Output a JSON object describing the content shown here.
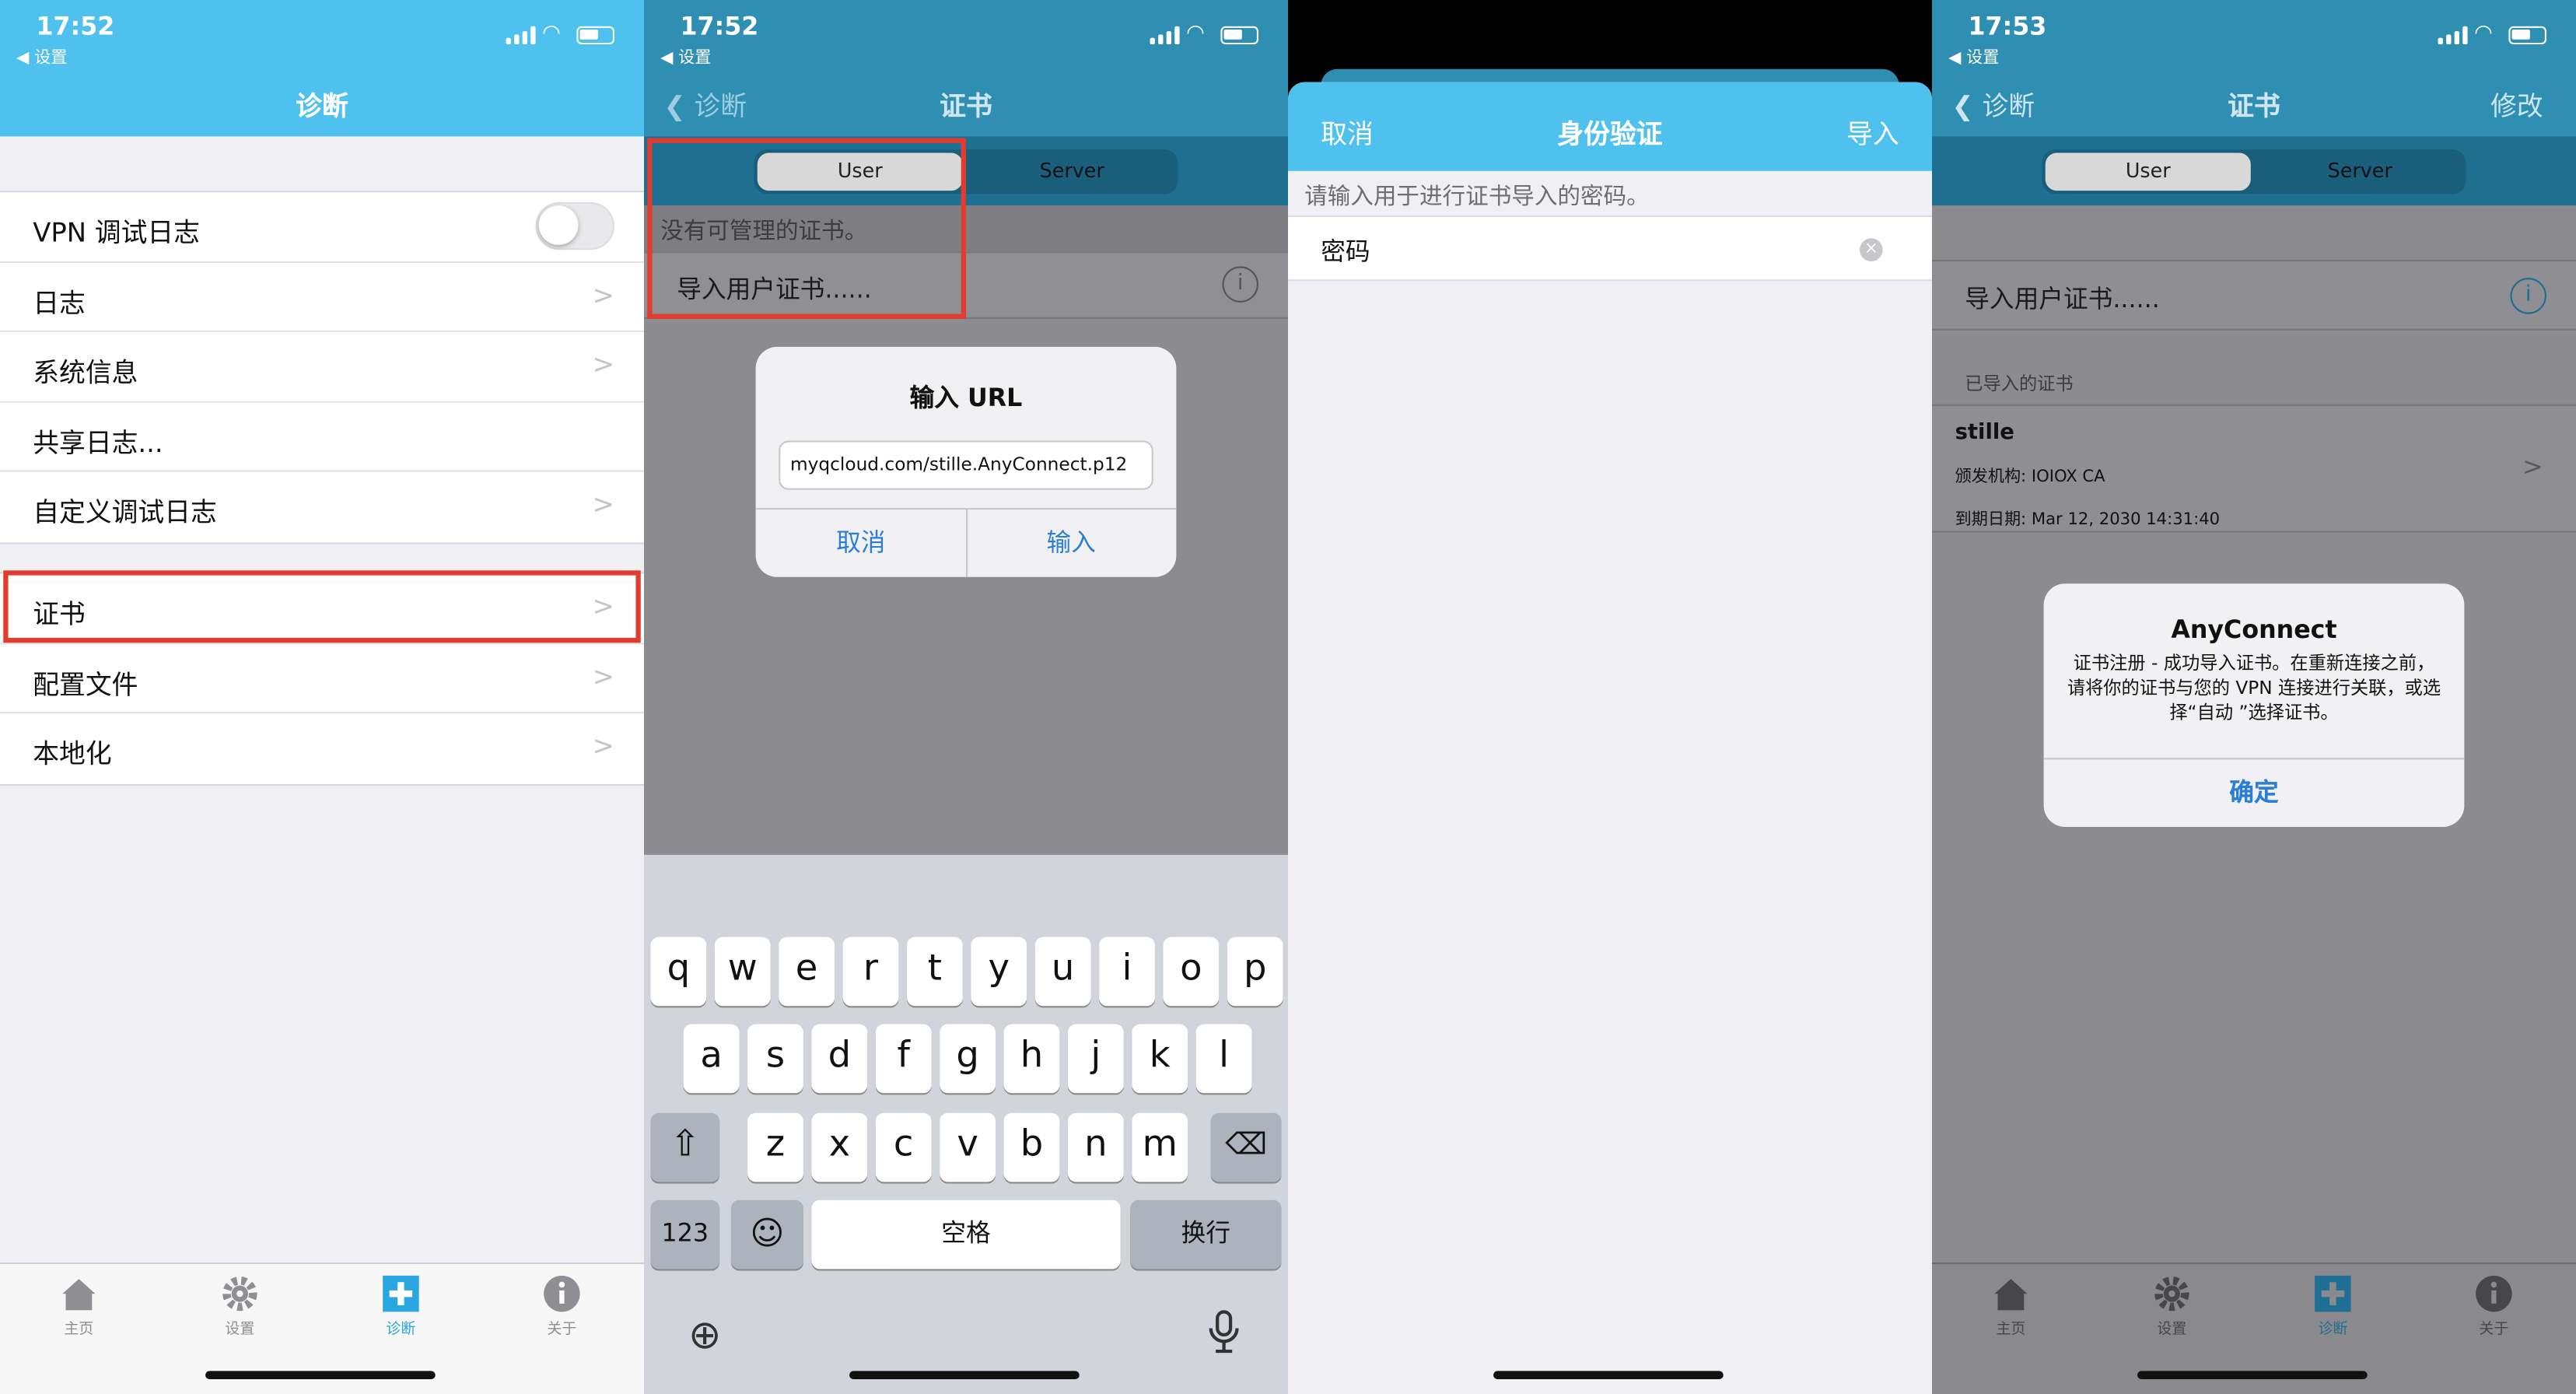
{
  "status": {
    "time_1": "17:52",
    "time_2": "17:52",
    "time_4": "17:53",
    "back_app": "◀ 设置"
  },
  "p1": {
    "title": "诊断",
    "items": [
      {
        "label": "VPN 调试日志"
      },
      {
        "label": "日志"
      },
      {
        "label": "系统信息"
      },
      {
        "label": "共享日志..."
      },
      {
        "label": "自定义调试日志"
      }
    ],
    "items2": [
      {
        "label": "证书"
      },
      {
        "label": "配置文件"
      },
      {
        "label": "本地化"
      }
    ]
  },
  "tabs": {
    "home": "主页",
    "settings": "设置",
    "diag": "诊断",
    "about": "关于"
  },
  "p2": {
    "back": "诊断",
    "title": "证书",
    "seg_user": "User",
    "seg_server": "Server",
    "empty": "没有可管理的证书。",
    "import": "导入用户证书......",
    "alert": {
      "title": "输入 URL",
      "url": "myqcloud.com/stille.AnyConnect.p12",
      "cancel": "取消",
      "ok": "输入"
    },
    "keyboard": {
      "row1": [
        "q",
        "w",
        "e",
        "r",
        "t",
        "y",
        "u",
        "i",
        "o",
        "p"
      ],
      "row2": [
        "a",
        "s",
        "d",
        "f",
        "g",
        "h",
        "j",
        "k",
        "l"
      ],
      "row3": [
        "z",
        "x",
        "c",
        "v",
        "b",
        "n",
        "m"
      ],
      "num": "123",
      "space": "空格",
      "return": "换行"
    }
  },
  "p3": {
    "cancel": "取消",
    "title": "身份验证",
    "import": "导入",
    "hint": "请输入用于进行证书导入的密码。",
    "field": "密码"
  },
  "p4": {
    "back": "诊断",
    "title": "证书",
    "edit": "修改",
    "seg_user": "User",
    "seg_server": "Server",
    "import": "导入用户证书......",
    "section": "已导入的证书",
    "cert": {
      "name": "stille",
      "issuer": "颁发机构: IOIOX CA",
      "expiry": "到期日期: Mar 12, 2030 14:31:40"
    },
    "alert": {
      "title": "AnyConnect",
      "msg": "证书注册 - 成功导入证书。在重新连接之前，请将你的证书与您的 VPN 连接进行关联，或选择“自动 ”选择证书。",
      "ok": "确定"
    }
  },
  "colors": {
    "nav": "#4fc1ef",
    "link": "#2a7fd4",
    "highlight": "#e13c30"
  }
}
